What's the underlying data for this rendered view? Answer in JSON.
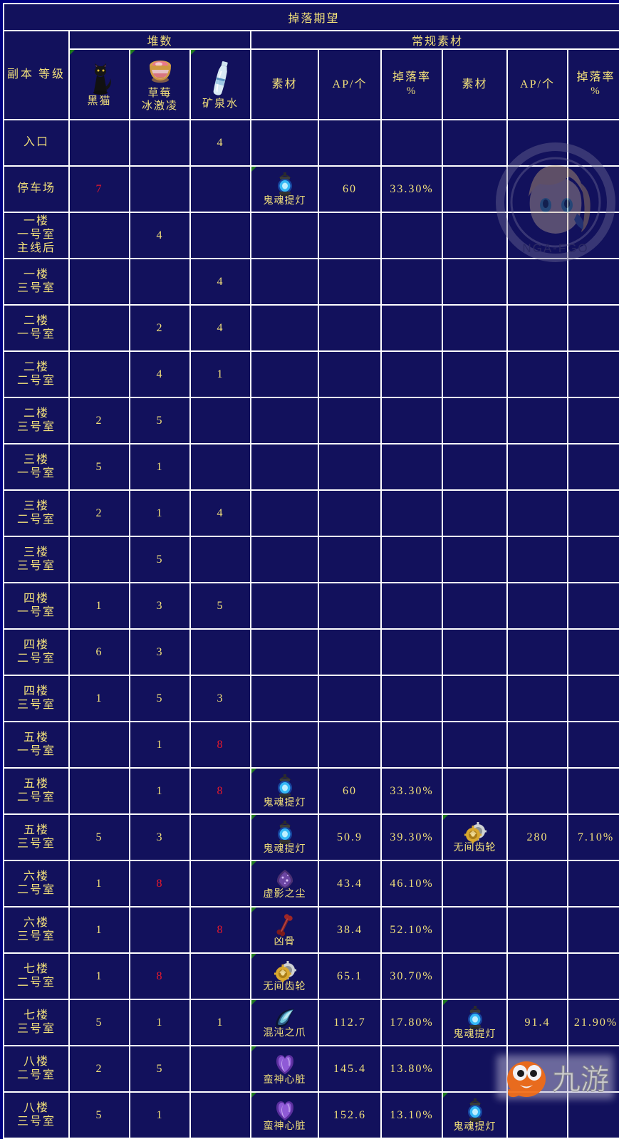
{
  "title": "掉落期望",
  "groups": {
    "stacks": "堆数",
    "normal": "常规素材"
  },
  "headers": {
    "level": {
      "l1": "副本",
      "l2": "等级"
    },
    "stack_items": [
      {
        "icon": "black-cat-icon",
        "name_l1": "黑猫",
        "name_l2": ""
      },
      {
        "icon": "strawberry-shaved-ice-icon",
        "name_l1": "草莓",
        "name_l2": "冰激凌"
      },
      {
        "icon": "mineral-water-icon",
        "name_l1": "矿泉水",
        "name_l2": ""
      }
    ],
    "material": "素材",
    "ap": "AP/个",
    "rate_l1": "掉落率",
    "rate_l2": "%"
  },
  "materials": {
    "lantern": "鬼魂提灯",
    "gear": "无间齿轮",
    "dust": "虚影之尘",
    "bone": "凶骨",
    "claw": "混沌之爪",
    "heart": "蛮神心脏"
  },
  "colors": {
    "page_bg": "#000080",
    "cell_bg": "#12115c",
    "grid": "#ffffff",
    "text": "#f2e07a",
    "title": "#f3d75f",
    "highlight_red": "#e8192c",
    "corner_marker": "#1f7a1f"
  },
  "watermarks": {
    "nga": "NGA-FGO版主权",
    "jiuyou": "九游"
  },
  "rows": [
    {
      "level": [
        "入口"
      ],
      "cat": "",
      "straw": "",
      "water": "4",
      "m1": "",
      "m1icon": "",
      "ap1": "",
      "rate1": "",
      "m2": "",
      "m2icon": "",
      "ap2": "",
      "rate2": ""
    },
    {
      "level": [
        "停车场"
      ],
      "cat": "7",
      "cat_red": true,
      "straw": "",
      "water": "",
      "m1": "鬼魂提灯",
      "m1icon": "lantern",
      "ap1": "60",
      "rate1": "33.30%",
      "m2": "",
      "m2icon": "",
      "ap2": "",
      "rate2": ""
    },
    {
      "level": [
        "一楼",
        "一号室",
        "主线后"
      ],
      "cat": "",
      "straw": "4",
      "water": "",
      "m1": "",
      "m1icon": "",
      "ap1": "",
      "rate1": "",
      "m2": "",
      "m2icon": "",
      "ap2": "",
      "rate2": ""
    },
    {
      "level": [
        "一楼",
        "三号室"
      ],
      "cat": "",
      "straw": "",
      "water": "4",
      "m1": "",
      "m1icon": "",
      "ap1": "",
      "rate1": "",
      "m2": "",
      "m2icon": "",
      "ap2": "",
      "rate2": ""
    },
    {
      "level": [
        "二楼",
        "一号室"
      ],
      "cat": "",
      "straw": "2",
      "water": "4",
      "m1": "",
      "m1icon": "",
      "ap1": "",
      "rate1": "",
      "m2": "",
      "m2icon": "",
      "ap2": "",
      "rate2": ""
    },
    {
      "level": [
        "二楼",
        "二号室"
      ],
      "cat": "",
      "straw": "4",
      "water": "1",
      "m1": "",
      "m1icon": "",
      "ap1": "",
      "rate1": "",
      "m2": "",
      "m2icon": "",
      "ap2": "",
      "rate2": ""
    },
    {
      "level": [
        "二楼",
        "三号室"
      ],
      "cat": "2",
      "straw": "5",
      "water": "",
      "m1": "",
      "m1icon": "",
      "ap1": "",
      "rate1": "",
      "m2": "",
      "m2icon": "",
      "ap2": "",
      "rate2": ""
    },
    {
      "level": [
        "三楼",
        "一号室"
      ],
      "cat": "5",
      "straw": "1",
      "water": "",
      "m1": "",
      "m1icon": "",
      "ap1": "",
      "rate1": "",
      "m2": "",
      "m2icon": "",
      "ap2": "",
      "rate2": ""
    },
    {
      "level": [
        "三楼",
        "二号室"
      ],
      "cat": "2",
      "straw": "1",
      "water": "4",
      "m1": "",
      "m1icon": "",
      "ap1": "",
      "rate1": "",
      "m2": "",
      "m2icon": "",
      "ap2": "",
      "rate2": ""
    },
    {
      "level": [
        "三楼",
        "三号室"
      ],
      "cat": "",
      "straw": "5",
      "water": "",
      "m1": "",
      "m1icon": "",
      "ap1": "",
      "rate1": "",
      "m2": "",
      "m2icon": "",
      "ap2": "",
      "rate2": ""
    },
    {
      "level": [
        "四楼",
        "一号室"
      ],
      "cat": "1",
      "straw": "3",
      "water": "5",
      "m1": "",
      "m1icon": "",
      "ap1": "",
      "rate1": "",
      "m2": "",
      "m2icon": "",
      "ap2": "",
      "rate2": ""
    },
    {
      "level": [
        "四楼",
        "二号室"
      ],
      "cat": "6",
      "straw": "3",
      "water": "",
      "m1": "",
      "m1icon": "",
      "ap1": "",
      "rate1": "",
      "m2": "",
      "m2icon": "",
      "ap2": "",
      "rate2": ""
    },
    {
      "level": [
        "四楼",
        "三号室"
      ],
      "cat": "1",
      "straw": "5",
      "water": "3",
      "m1": "",
      "m1icon": "",
      "ap1": "",
      "rate1": "",
      "m2": "",
      "m2icon": "",
      "ap2": "",
      "rate2": ""
    },
    {
      "level": [
        "五楼",
        "一号室"
      ],
      "cat": "",
      "straw": "1",
      "water": "8",
      "water_red": true,
      "m1": "",
      "m1icon": "",
      "ap1": "",
      "rate1": "",
      "m2": "",
      "m2icon": "",
      "ap2": "",
      "rate2": ""
    },
    {
      "level": [
        "五楼",
        "二号室"
      ],
      "cat": "",
      "straw": "1",
      "water": "8",
      "water_red": true,
      "m1": "鬼魂提灯",
      "m1icon": "lantern",
      "ap1": "60",
      "rate1": "33.30%",
      "m2": "",
      "m2icon": "",
      "ap2": "",
      "rate2": ""
    },
    {
      "level": [
        "五楼",
        "三号室"
      ],
      "cat": "5",
      "straw": "3",
      "water": "",
      "m1": "鬼魂提灯",
      "m1icon": "lantern",
      "ap1": "50.9",
      "rate1": "39.30%",
      "m2": "无间齿轮",
      "m2icon": "gear",
      "ap2": "280",
      "rate2": "7.10%"
    },
    {
      "level": [
        "六楼",
        "二号室"
      ],
      "cat": "1",
      "straw": "8",
      "straw_red": true,
      "water": "",
      "m1": "虚影之尘",
      "m1icon": "dust",
      "ap1": "43.4",
      "rate1": "46.10%",
      "m2": "",
      "m2icon": "",
      "ap2": "",
      "rate2": ""
    },
    {
      "level": [
        "六楼",
        "三号室"
      ],
      "cat": "1",
      "straw": "",
      "water": "8",
      "water_red": true,
      "m1": "凶骨",
      "m1icon": "bone",
      "ap1": "38.4",
      "rate1": "52.10%",
      "m2": "",
      "m2icon": "",
      "ap2": "",
      "rate2": ""
    },
    {
      "level": [
        "七楼",
        "二号室"
      ],
      "cat": "1",
      "straw": "8",
      "straw_red": true,
      "water": "",
      "m1": "无间齿轮",
      "m1icon": "gear",
      "ap1": "65.1",
      "rate1": "30.70%",
      "m2": "",
      "m2icon": "",
      "ap2": "",
      "rate2": ""
    },
    {
      "level": [
        "七楼",
        "三号室"
      ],
      "cat": "5",
      "straw": "1",
      "water": "1",
      "m1": "混沌之爪",
      "m1icon": "claw",
      "ap1": "112.7",
      "rate1": "17.80%",
      "m2": "鬼魂提灯",
      "m2icon": "lantern",
      "ap2": "91.4",
      "rate2": "21.90%"
    },
    {
      "level": [
        "八楼",
        "二号室"
      ],
      "cat": "2",
      "straw": "5",
      "water": "",
      "m1": "蛮神心脏",
      "m1icon": "heart",
      "ap1": "145.4",
      "rate1": "13.80%",
      "m2": "",
      "m2icon": "",
      "ap2": "",
      "rate2": ""
    },
    {
      "level": [
        "八楼",
        "三号室"
      ],
      "cat": "5",
      "straw": "1",
      "water": "",
      "m1": "蛮神心脏",
      "m1icon": "heart",
      "ap1": "152.6",
      "rate1": "13.10%",
      "m2": "鬼魂提灯",
      "m2icon": "lantern",
      "ap2": "",
      "rate2": ""
    }
  ]
}
